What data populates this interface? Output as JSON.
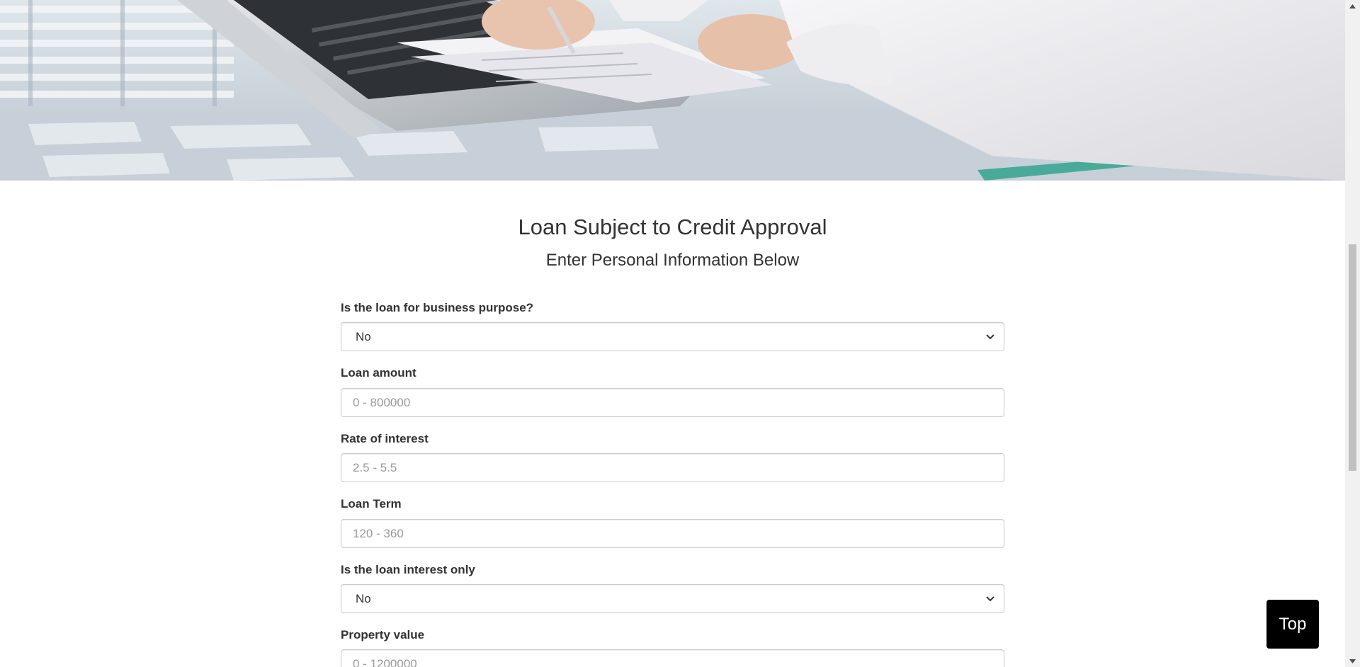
{
  "hero": {
    "image_description_icon": "hero-office-image"
  },
  "page": {
    "title": "Loan Subject to Credit Approval",
    "subtitle": "Enter Personal Information Below"
  },
  "form": {
    "business_purpose": {
      "label": "Is the loan for business purpose?",
      "value": "No"
    },
    "loan_amount": {
      "label": "Loan amount",
      "placeholder": "0 - 800000"
    },
    "rate_of_interest": {
      "label": "Rate of interest",
      "placeholder": "2.5 - 5.5"
    },
    "loan_term": {
      "label": "Loan Term",
      "placeholder": "120 - 360"
    },
    "interest_only": {
      "label": "Is the loan interest only",
      "value": "No"
    },
    "property_value": {
      "label": "Property value",
      "placeholder": "0 - 1200000"
    }
  },
  "top_button": {
    "label": "Top"
  },
  "colors": {
    "text": "#333333",
    "border": "#cccccc",
    "placeholder": "#999999",
    "top_button_bg": "#000000",
    "top_button_text": "#ffffff",
    "scrollbar_track": "#f1f1f1",
    "scrollbar_thumb": "#c1c1c1"
  }
}
